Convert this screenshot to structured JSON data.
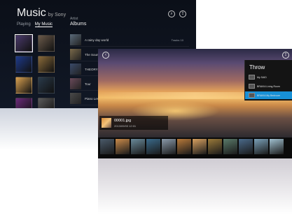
{
  "music": {
    "title": "Music",
    "by": "by Sony",
    "tabs": [
      "Playing",
      "My Music"
    ],
    "section_label": "Artist",
    "section_title": "Albums",
    "tiles": [
      "#4a3a6a",
      "#6a5a4a",
      "#1e3a8a",
      "#8a6a3a",
      "#d8a050",
      "#2a3a4a",
      "#6a2a7a",
      "#5a5a5a"
    ],
    "albums": [
      {
        "name": "A rainy day world",
        "meta": "",
        "color": "#5a6a7a"
      },
      {
        "name": "The Sounds ...",
        "meta": "",
        "color": "#7a6a4a"
      },
      {
        "name": "THEORY VALLEY",
        "meta": "",
        "color": "#3a4a6a"
      },
      {
        "name": "Tour",
        "meta": "",
        "color": "#6a4a5a"
      },
      {
        "name": "Piano Lesson",
        "meta": "",
        "color": "#4a4a4a"
      }
    ],
    "album_count": "Tracks 10"
  },
  "photo": {
    "file_name": "00001.jpg",
    "file_date": "2013/09/03 12:01",
    "throw": {
      "title": "Throw",
      "devices": [
        {
          "label": "My SAID",
          "active": false
        },
        {
          "label": "BRAVIA Living Room",
          "active": false
        },
        {
          "label": "BRAVIA My Bedroom",
          "active": true
        }
      ]
    },
    "filmstrip": [
      "#4a5a6a",
      "#c98a4a",
      "#6a8a9a",
      "#3a6a8a",
      "#8a9aaa",
      "#b87a3a",
      "#d8a060",
      "#9a7a3a",
      "#5a7a6a",
      "#4a6a8a",
      "#7aa0b8",
      "#a0c0d0"
    ]
  }
}
